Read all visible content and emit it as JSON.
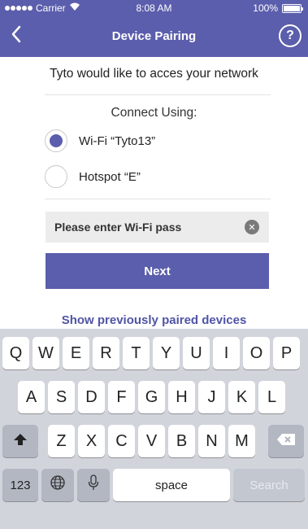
{
  "status_bar": {
    "carrier": "Carrier",
    "time": "8:08 AM",
    "battery": "100%"
  },
  "nav": {
    "title": "Device Pairing",
    "help": "?",
    "back_icon": "chevron-left-icon"
  },
  "content": {
    "headline": "Tyto would like to acces your network",
    "connect_label": "Connect Using:",
    "options": [
      {
        "label": "Wi-Fi “Tyto13”",
        "selected": true
      },
      {
        "label": "Hotspot “E”",
        "selected": false
      }
    ],
    "password_field": {
      "value": "Please enter Wi-Fi pass",
      "clear_icon": "clear-circle-icon"
    },
    "next_label": "Next",
    "previous_link": "Show previously paired devices"
  },
  "keyboard": {
    "row1": [
      "Q",
      "W",
      "E",
      "R",
      "T",
      "Y",
      "U",
      "I",
      "O",
      "P"
    ],
    "row2": [
      "A",
      "S",
      "D",
      "F",
      "G",
      "H",
      "J",
      "K",
      "L"
    ],
    "row3": [
      "Z",
      "X",
      "C",
      "V",
      "B",
      "N",
      "M"
    ],
    "numbers_key": "123",
    "space_key": "space",
    "search_key": "Search",
    "shift_icon": "shift-icon",
    "delete_icon": "delete-icon",
    "globe_icon": "globe-icon",
    "mic_icon": "microphone-icon"
  },
  "colors": {
    "accent": "#5b5eac",
    "link": "#4f54a6",
    "keyboard_bg": "#d1d4db"
  }
}
